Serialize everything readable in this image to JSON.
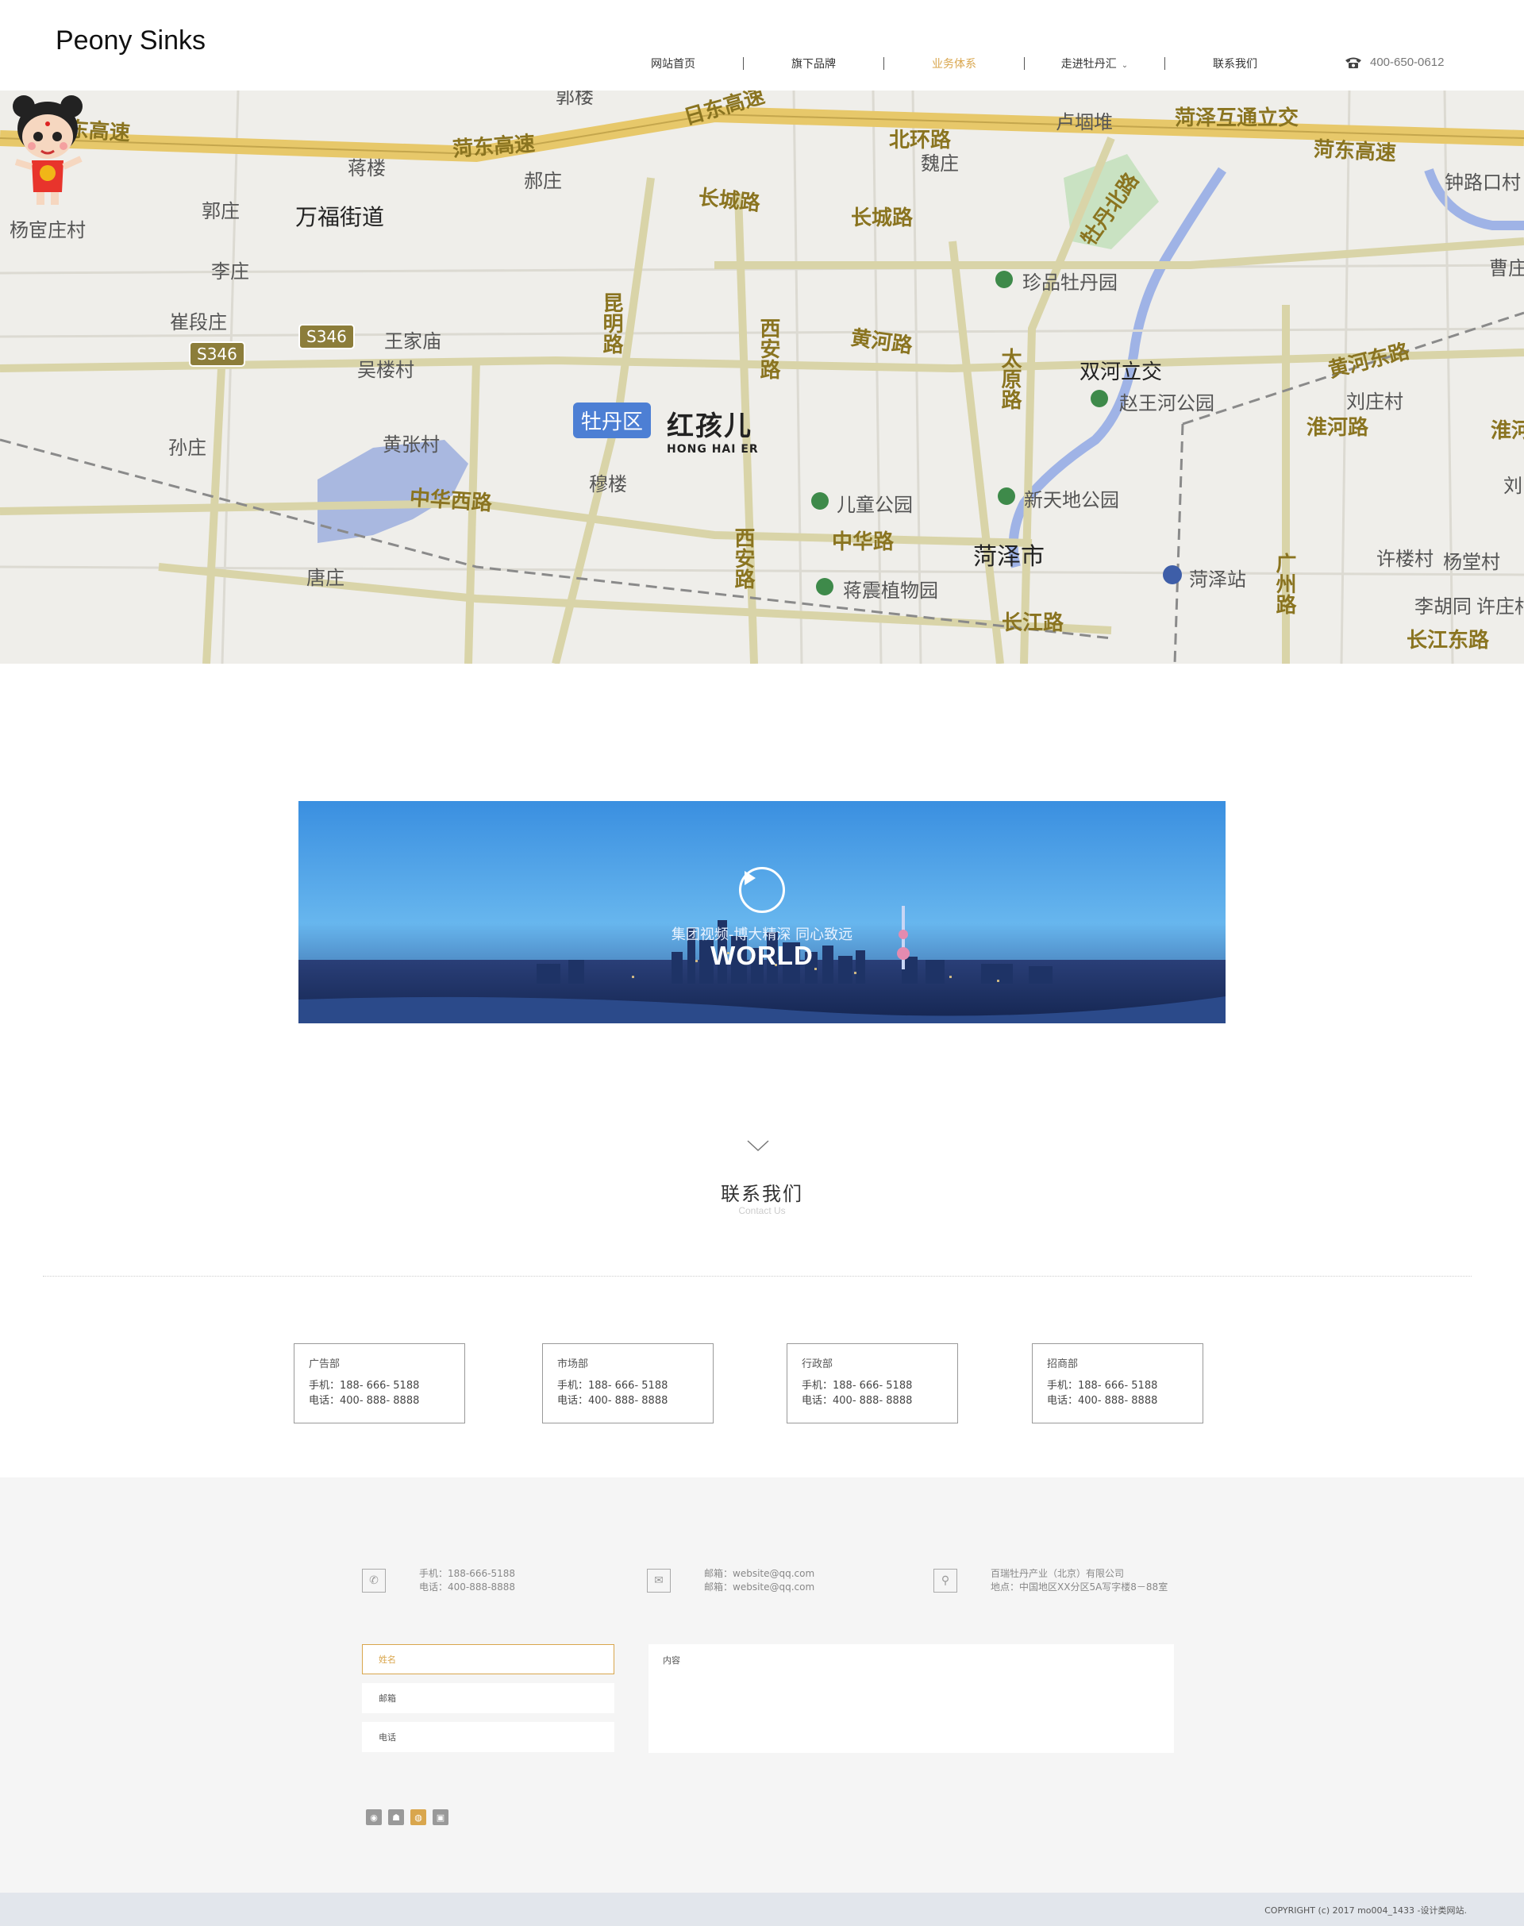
{
  "header": {
    "logo": "Peony Sinks",
    "nav": [
      {
        "label": "网站首页",
        "active": false
      },
      {
        "label": "旗下品牌",
        "active": false
      },
      {
        "label": "业务体系",
        "active": true
      },
      {
        "label": "走进牡丹汇",
        "active": false,
        "dropdown": true
      },
      {
        "label": "联系我们",
        "active": false
      }
    ],
    "phone": "400-650-0612",
    "accent_color": "#d9a64d"
  },
  "map": {
    "district_badge": "牡丹区",
    "brand_cn": "红孩儿",
    "brand_en": "HONG HAI ER",
    "routes": [
      "S346",
      "S346"
    ],
    "labels": {
      "l1": "日东高速",
      "l2": "菏东高速",
      "l3": "蒋楼",
      "l4": "郝庄",
      "l5": "北环路",
      "l6": "魏庄",
      "l7": "卢堌堆",
      "l8": "菏泽互通立交",
      "l9": "菏东高速",
      "l10": "钟路口村",
      "l11": "日东高速",
      "l12": "杨宦庄村",
      "l13": "郭庄",
      "l14": "万福街道",
      "l15": "李庄",
      "l16": "长城路",
      "l17": "长城路",
      "l18": "牡丹北路",
      "l19": "珍品牡丹园",
      "l20": "曹庄",
      "l21": "崔段庄",
      "l22": "王家庙",
      "l23": "吴楼村",
      "l24": "昆明路",
      "l25": "西安路",
      "l26": "黄河路",
      "l27": "太原路",
      "l28": "双河立交",
      "l29": "赵王河公园",
      "l30": "黄河东路",
      "l31": "刘庄村",
      "l32": "淮河路",
      "l33": "淮河",
      "l34": "孙庄",
      "l35": "黄张村",
      "l36": "穆楼",
      "l37": "儿童公园",
      "l38": "新天地公园",
      "l39": "刘",
      "l40": "中华西路",
      "l41": "中华路",
      "l42": "菏泽市",
      "l43": "许楼村",
      "l44": "杨堂村",
      "l45": "唐庄",
      "l46": "西安路",
      "l47": "蒋震植物园",
      "l48": "菏泽站",
      "l49": "广州路",
      "l50": "李胡同",
      "l51": "许庄村",
      "l52": "长江路",
      "l53": "长江东路",
      "l54": "郭楼"
    }
  },
  "video": {
    "subtitle": "集团视频-博大精深 同心致远",
    "title": "WORLD"
  },
  "contact": {
    "title": "联系我们",
    "subtitle": "Contact Us",
    "departments": [
      {
        "name": "广告部",
        "mobile": "手机：188- 666- 5188",
        "tel": "电话：400- 888- 8888"
      },
      {
        "name": "市场部",
        "mobile": "手机：188- 666- 5188",
        "tel": "电话：400- 888- 8888"
      },
      {
        "name": "行政部",
        "mobile": "手机：188- 666- 5188",
        "tel": "电话：400- 888- 8888"
      },
      {
        "name": "招商部",
        "mobile": "手机：188- 666- 5188",
        "tel": "电话：400- 888- 8888"
      }
    ]
  },
  "footer": {
    "phone": {
      "line1": "手机：188-666-5188",
      "line2": "电话：400-888-8888"
    },
    "email": {
      "line1": "邮箱：website@qq.com",
      "line2": "邮箱：website@qq.com"
    },
    "address": {
      "line1": "百瑞牡丹产业（北京）有限公司",
      "line2": "地点：中国地区XX分区5A写字楼8－88室"
    },
    "form": {
      "name": "姓名",
      "email": "邮箱",
      "phone": "电话",
      "content": "内容"
    },
    "copyright": "COPYRIGHT (c) 2017 mo004_1433 -设计类网站."
  }
}
